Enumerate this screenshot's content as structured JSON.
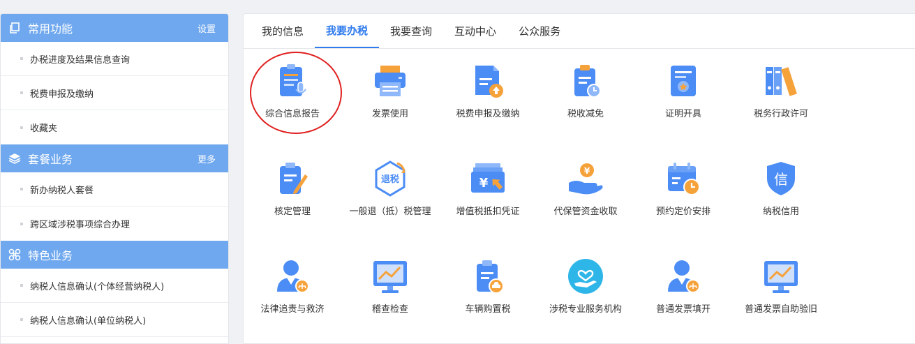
{
  "sidebar": {
    "sections": [
      {
        "title": "常用功能",
        "link": "设置",
        "items": [
          "办税进度及结果信息查询",
          "税费申报及缴纳",
          "收藏夹"
        ]
      },
      {
        "title": "套餐业务",
        "link": "更多",
        "items": [
          "新办纳税人套餐",
          "跨区域涉税事项综合办理"
        ]
      },
      {
        "title": "特色业务",
        "items": [
          "纳税人信息确认(个体经营纳税人)",
          "纳税人信息确认(单位纳税人)"
        ]
      }
    ]
  },
  "main": {
    "tabs": [
      "我的信息",
      "我要办税",
      "我要查询",
      "互动中心",
      "公众服务"
    ],
    "active_tab": "我要办税",
    "tiles": [
      {
        "label": "综合信息报告",
        "icon": "report-mic-icon"
      },
      {
        "label": "发票使用",
        "icon": "printer-icon"
      },
      {
        "label": "税费申报及缴纳",
        "icon": "upload-doc-icon"
      },
      {
        "label": "税收减免",
        "icon": "clipboard-clock-icon"
      },
      {
        "label": "证明开具",
        "icon": "certificate-icon"
      },
      {
        "label": "税务行政许可",
        "icon": "binders-icon"
      },
      {
        "label": "核定管理",
        "icon": "clipboard-pen-icon"
      },
      {
        "label": "一般退（抵）税管理",
        "icon": "refund-tax-icon",
        "badge": "退税"
      },
      {
        "label": "增值税抵扣凭证",
        "icon": "yuan-voucher-icon"
      },
      {
        "label": "代保管资金收取",
        "icon": "hand-coin-icon"
      },
      {
        "label": "预约定价安排",
        "icon": "calendar-clock-icon"
      },
      {
        "label": "纳税信用",
        "icon": "credit-shield-icon",
        "badge": "信"
      },
      {
        "label": "法律追责与救济",
        "icon": "person-scale-icon"
      },
      {
        "label": "稽查检查",
        "icon": "monitor-chart-icon"
      },
      {
        "label": "车辆购置税",
        "icon": "clipboard-car-icon"
      },
      {
        "label": "涉税专业服务机构",
        "icon": "heart-hand-icon"
      },
      {
        "label": "普通发票填开",
        "icon": "person-scale-icon"
      },
      {
        "label": "普通发票自助验旧",
        "icon": "monitor-chart-icon"
      }
    ]
  },
  "colors": {
    "accent": "#2f7bed",
    "sidebar_header": "#6fa8ee",
    "highlight_circle": "#e02020",
    "icon_blue": "#4b8cf5",
    "icon_orange": "#f6a23b"
  }
}
